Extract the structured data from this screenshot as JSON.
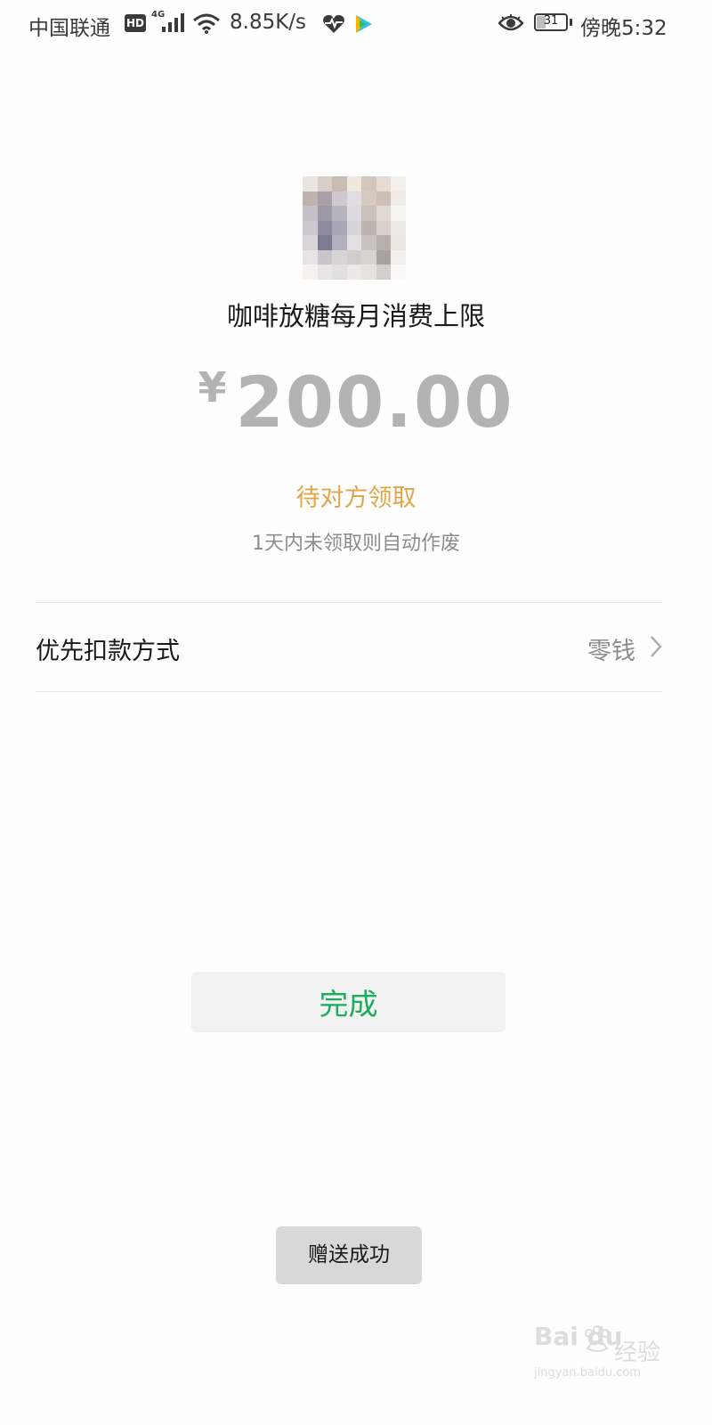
{
  "status_bar": {
    "carrier": "中国联通",
    "hd_label": "HD",
    "network_type": "4G",
    "speed": "8.85K/s",
    "battery": "31",
    "battery_level": 0.31,
    "time": "傍晚5:32",
    "icons": [
      "hd-icon",
      "signal-icon",
      "wifi-icon",
      "health-icon",
      "video-play-icon",
      "eye-icon",
      "battery-icon"
    ]
  },
  "gift": {
    "title": "咖啡放糖每月消费上限",
    "currency_symbol": "¥",
    "amount": "200.00",
    "status": "待对方领取",
    "expire_note": "1天内未领取则自动作废"
  },
  "payment": {
    "label": "优先扣款方式",
    "value": "零钱"
  },
  "done_button_label": "完成",
  "toast": "赠送成功",
  "watermark": {
    "logo": "Bai du",
    "brand_cn": "经验",
    "url": "jingyan.baidu.com"
  },
  "colors": {
    "amount": "#b3b3b3",
    "status_pending": "#e2a64a",
    "done_button_text": "#1aad5a",
    "toast_bg": "#d8d8d8"
  }
}
